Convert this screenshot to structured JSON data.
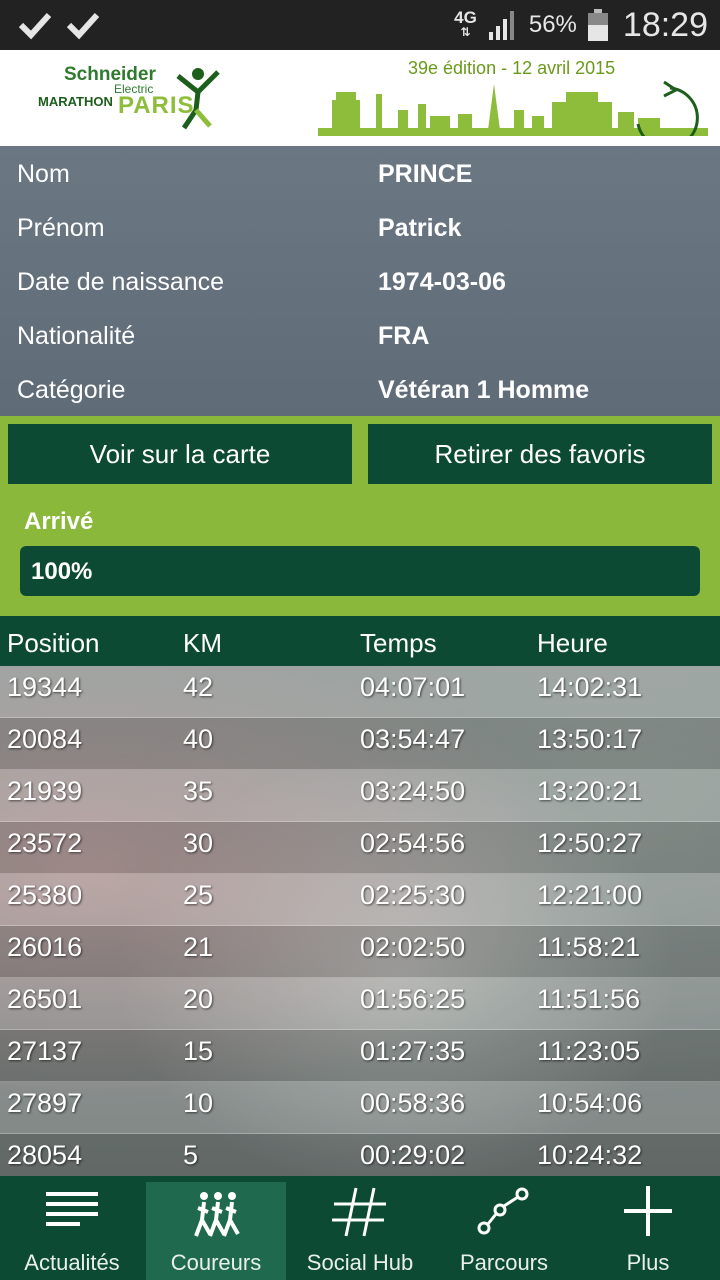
{
  "status": {
    "network": "4G",
    "battery": "56%",
    "time": "18:29"
  },
  "banner": {
    "logo_line1": "Schneider",
    "logo_line2": "Electric",
    "logo_line3": "MARATHON",
    "logo_line4": "PARIS",
    "edition": "39e édition - 12 avril 2015"
  },
  "runner": [
    {
      "label": "Nom",
      "value": "PRINCE"
    },
    {
      "label": "Prénom",
      "value": "Patrick"
    },
    {
      "label": "Date de naissance",
      "value": "1974-03-06"
    },
    {
      "label": "Nationalité",
      "value": "FRA"
    },
    {
      "label": "Catégorie",
      "value": "Vétéran 1 Homme"
    }
  ],
  "actions": {
    "map_button": "Voir sur la carte",
    "favorites_button": "Retirer des favoris"
  },
  "progress": {
    "label": "Arrivé",
    "text": "100%",
    "fraction": 1.0
  },
  "table": {
    "headers": [
      "Position",
      "KM",
      "Temps",
      "Heure"
    ],
    "rows": [
      [
        "19344",
        "42",
        "04:07:01",
        "14:02:31"
      ],
      [
        "20084",
        "40",
        "03:54:47",
        "13:50:17"
      ],
      [
        "21939",
        "35",
        "03:24:50",
        "13:20:21"
      ],
      [
        "23572",
        "30",
        "02:54:56",
        "12:50:27"
      ],
      [
        "25380",
        "25",
        "02:25:30",
        "12:21:00"
      ],
      [
        "26016",
        "21",
        "02:02:50",
        "11:58:21"
      ],
      [
        "26501",
        "20",
        "01:56:25",
        "11:51:56"
      ],
      [
        "27137",
        "15",
        "01:27:35",
        "11:23:05"
      ],
      [
        "27897",
        "10",
        "00:58:36",
        "10:54:06"
      ],
      [
        "28054",
        "5",
        "00:29:02",
        "10:24:32"
      ]
    ]
  },
  "nav": [
    {
      "label": "Actualités",
      "icon": "news-lines-icon",
      "active": false
    },
    {
      "label": "Coureurs",
      "icon": "runners-icon",
      "active": true
    },
    {
      "label": "Social Hub",
      "icon": "hashtag-icon",
      "active": false
    },
    {
      "label": "Parcours",
      "icon": "route-icon",
      "active": false
    },
    {
      "label": "Plus",
      "icon": "plus-icon",
      "active": false
    }
  ],
  "colors": {
    "primary_dark_green": "#0d4a33",
    "accent_green": "#8ab83a",
    "identity_bg": "#6b7782"
  }
}
